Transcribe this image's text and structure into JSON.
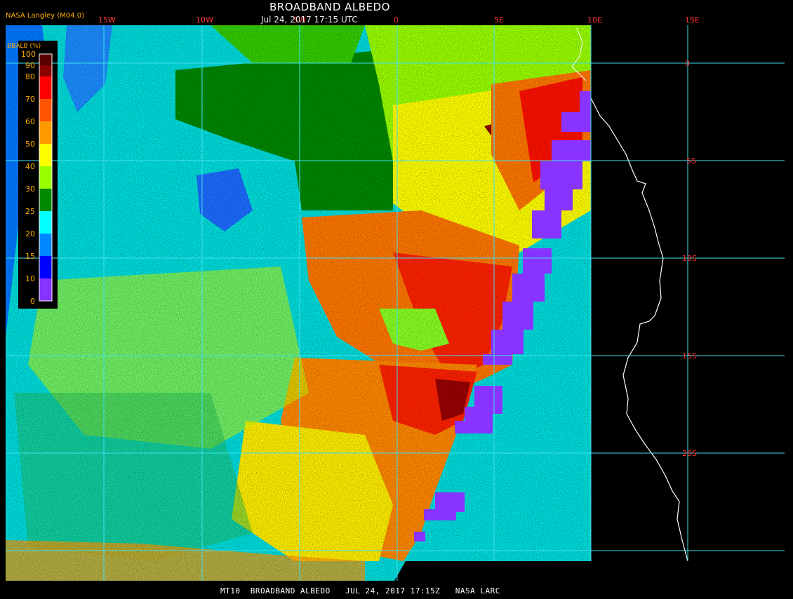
{
  "header": {
    "title": "BROADBAND ALBEDO",
    "datetime": "Jul 24, 2017 17:15 UTC",
    "source": "NASA Langley (M04.0)"
  },
  "footer": {
    "caption": "MT10  BROADBAND ALBEDO   JUL 24, 2017 17:15Z   NASA LARC"
  },
  "colorbar": {
    "title": "BBALB (%)",
    "ticks": [
      "100",
      "90",
      "80",
      "70",
      "60",
      "50",
      "40",
      "30",
      "25",
      "20",
      "15",
      "10",
      "0"
    ],
    "colors": [
      "#5a0000",
      "#8b0000",
      "#ff0000",
      "#ff5500",
      "#ff9900",
      "#ffff00",
      "#99ff00",
      "#008800",
      "#00ffff",
      "#0088ff",
      "#0000ff",
      "#8833ff"
    ]
  },
  "map": {
    "projection": "lat/lon grid",
    "lon_labels": [
      "15W",
      "10W",
      "5W",
      "0",
      "5E",
      "10E",
      "15E"
    ],
    "lat_labels": [
      "0",
      "5S",
      "10S",
      "15S",
      "20S"
    ],
    "grid_color": "#40e0f0",
    "no_data_color": "#000000",
    "clear_ocean_color": "#8833ff",
    "coastline_color": "#ffffff"
  }
}
